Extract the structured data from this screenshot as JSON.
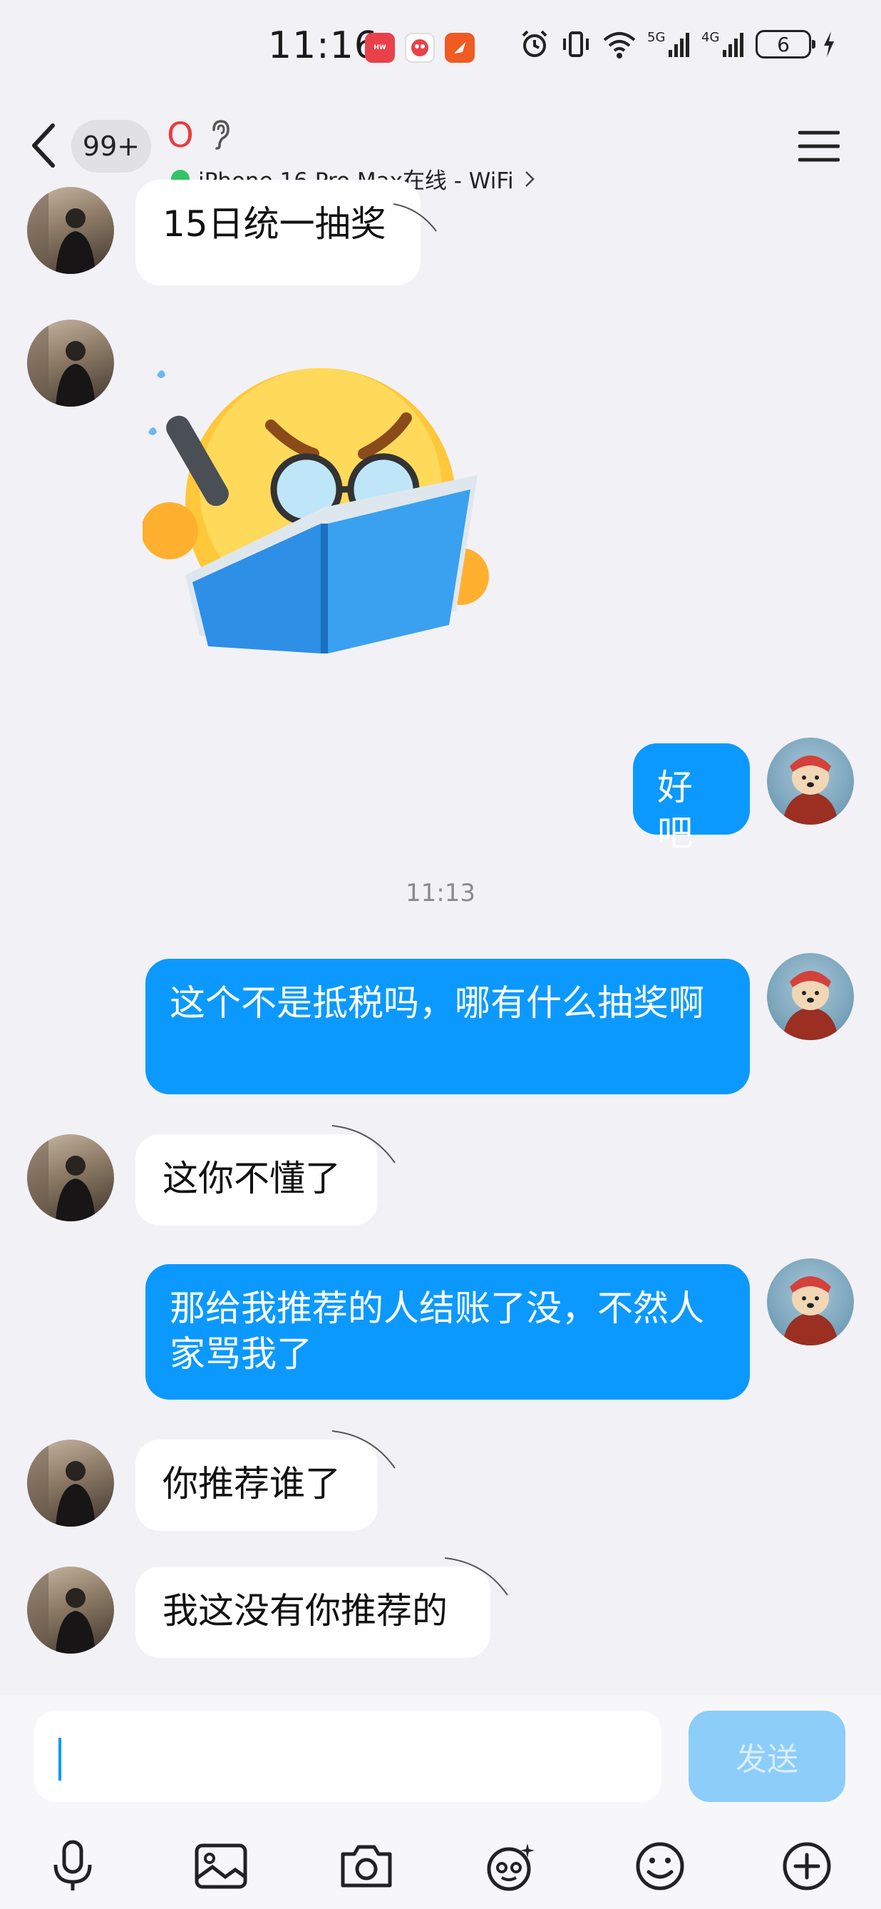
{
  "status_bar": {
    "time": "11:16",
    "battery": "6",
    "network_5g": "5G",
    "network_4g": "4G"
  },
  "header": {
    "unread_count": "99+",
    "contact_name": "O",
    "online_status": "iPhone 16 Pro Max在线 - WiFi"
  },
  "messages": [
    {
      "side": "left",
      "text": "15日统一抽奖"
    },
    {
      "side": "left",
      "type": "sticker",
      "sticker": "reading-emoji"
    },
    {
      "side": "right",
      "text": "好吧"
    },
    {
      "type": "time",
      "text": "11:13"
    },
    {
      "side": "right",
      "text": "这个不是抵税吗，哪有什么抽奖啊"
    },
    {
      "side": "left",
      "text": "这你不懂了"
    },
    {
      "side": "right",
      "text": "那给我推荐的人结账了没，不然人家骂我了"
    },
    {
      "side": "left",
      "text": "你推荐谁了"
    },
    {
      "side": "left",
      "text": "我这没有你推荐的"
    }
  ],
  "input": {
    "value": "",
    "send_label": "发送"
  },
  "toolbar": [
    "mic-icon",
    "image-icon",
    "camera-icon",
    "sticker-face-icon",
    "emoji-icon",
    "plus-icon"
  ]
}
